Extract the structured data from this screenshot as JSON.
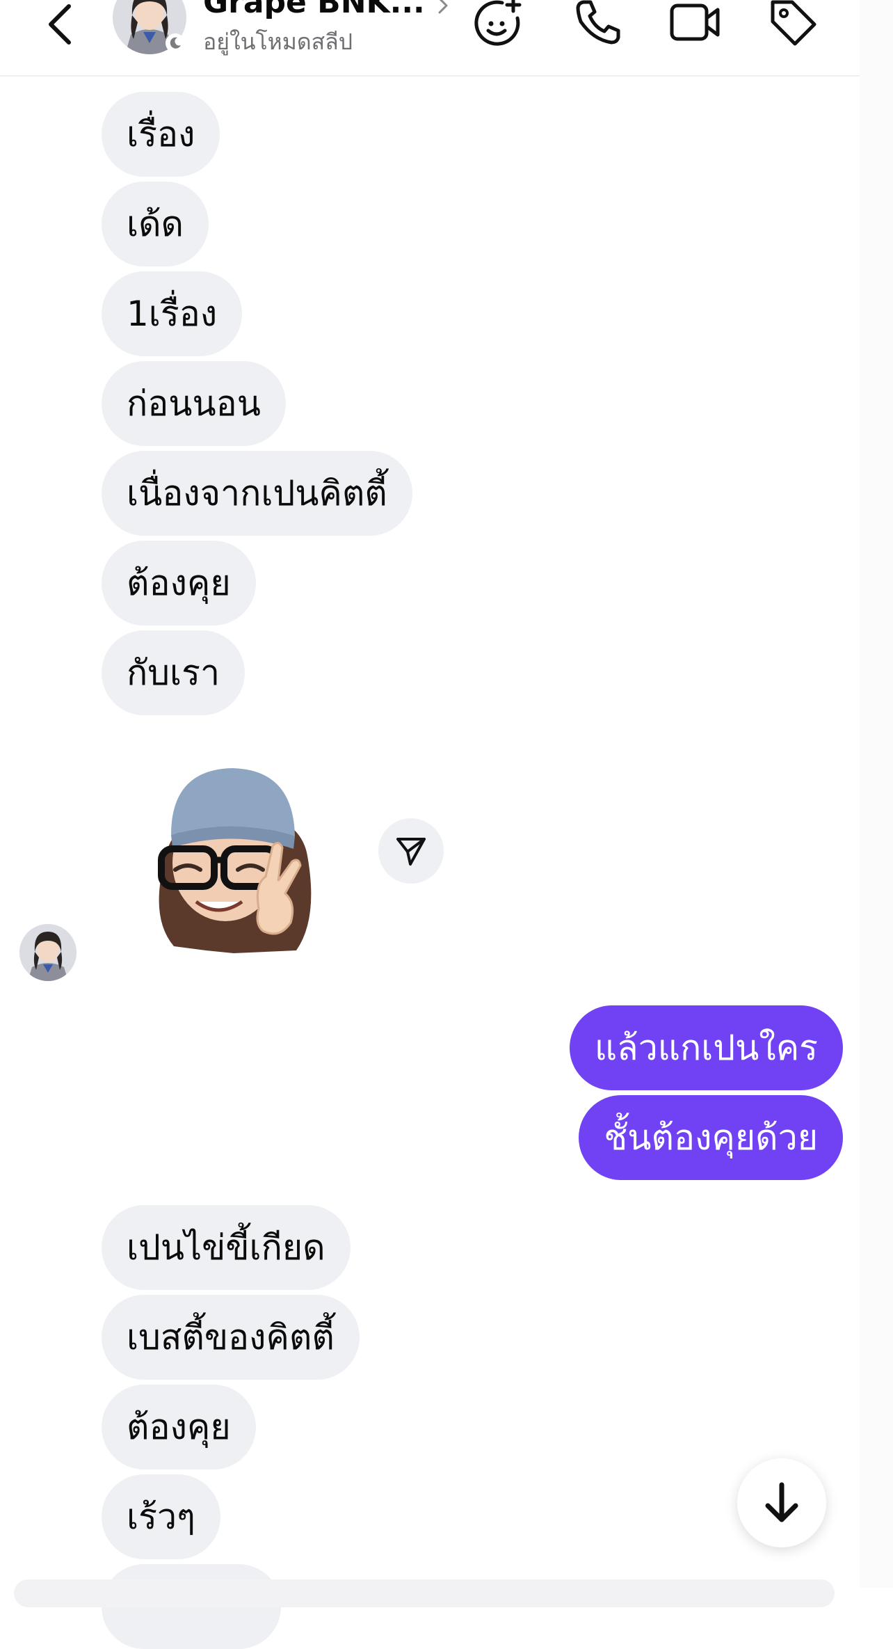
{
  "header": {
    "contact_name": "Grape BNK...",
    "status": "อยู่ในโหมดสลีป"
  },
  "messages": [
    {
      "direction": "incoming",
      "text": "เรื่อง"
    },
    {
      "direction": "incoming",
      "text": "เด้ด"
    },
    {
      "direction": "incoming",
      "text": "1เรื่อง"
    },
    {
      "direction": "incoming",
      "text": "ก่อนนอน"
    },
    {
      "direction": "incoming",
      "text": "เนื่องจากเปนคิตตี้"
    },
    {
      "direction": "incoming",
      "text": "ต้องคุย"
    },
    {
      "direction": "incoming",
      "text": "กับเรา"
    },
    {
      "direction": "incoming",
      "type": "sticker",
      "icon": "memoji-sticker"
    },
    {
      "direction": "outgoing",
      "text": "แล้วแกเปนใคร"
    },
    {
      "direction": "outgoing",
      "text": "ชั้นต้องคุยด้วย"
    },
    {
      "direction": "incoming",
      "text": "เปนไข่ขี้เกียด"
    },
    {
      "direction": "incoming",
      "text": "เบสตี้ของคิตตี้"
    },
    {
      "direction": "incoming",
      "text": "ต้องคุย"
    },
    {
      "direction": "incoming",
      "text": "เร้วๆ"
    }
  ],
  "colors": {
    "accent": "#7042f4",
    "incoming_bubble": "#eff0f3",
    "background": "#ffffff",
    "secondary_text": "#6e6e73"
  },
  "icons": {
    "back": "chevron-left-icon",
    "effects": "face-sparkle-icon",
    "call": "phone-icon",
    "video": "video-camera-icon",
    "tag": "tag-icon",
    "share": "send-icon",
    "scroll_down": "arrow-down-icon"
  }
}
